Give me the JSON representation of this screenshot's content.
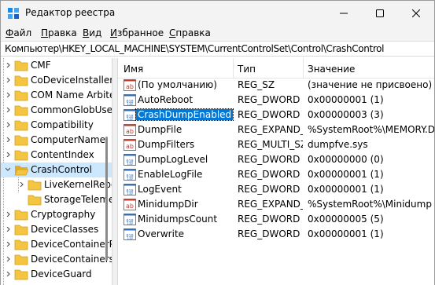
{
  "window": {
    "title": "Редактор реестра"
  },
  "menu": [
    {
      "accel": "Ф",
      "rest": "айл"
    },
    {
      "accel": "П",
      "rest": "равка"
    },
    {
      "accel": "В",
      "rest": "ид"
    },
    {
      "accel": "И",
      "rest": "збранное"
    },
    {
      "accel": "С",
      "rest": "правка"
    }
  ],
  "address": "Компьютер\\HKEY_LOCAL_MACHINE\\SYSTEM\\CurrentControlSet\\Control\\CrashControl",
  "tree": {
    "items": [
      {
        "label": "CMF"
      },
      {
        "label": "CoDeviceInstallers"
      },
      {
        "label": "COM Name Arbiter"
      },
      {
        "label": "CommonGlobUserSettings"
      },
      {
        "label": "Compatibility"
      },
      {
        "label": "ComputerName"
      },
      {
        "label": "ContentIndex"
      },
      {
        "label": "CrashControl"
      },
      {
        "label": "LiveKernelReports"
      },
      {
        "label": "StorageTelemetry"
      },
      {
        "label": "Cryptography"
      },
      {
        "label": "DeviceClasses"
      },
      {
        "label": "DeviceContainerPropertyUpdateEvents"
      },
      {
        "label": "DeviceContainers"
      },
      {
        "label": "DeviceGuard"
      }
    ]
  },
  "list": {
    "columns": {
      "name": "Имя",
      "type": "Тип",
      "data": "Значение"
    },
    "rows": [
      {
        "name": "(По умолчанию)",
        "type": "REG_SZ",
        "data": "(значение не присвоено)",
        "icon": "string-value-icon"
      },
      {
        "name": "AutoReboot",
        "type": "REG_DWORD",
        "data": "0x00000001 (1)",
        "icon": "binary-value-icon"
      },
      {
        "name": "CrashDumpEnabled",
        "type": "REG_DWORD",
        "data": "0x00000003 (3)",
        "icon": "binary-value-icon"
      },
      {
        "name": "DumpFile",
        "type": "REG_EXPAND_SZ",
        "data": "%SystemRoot%\\MEMORY.DMP",
        "icon": "string-value-icon"
      },
      {
        "name": "DumpFilters",
        "type": "REG_MULTI_SZ",
        "data": "dumpfve.sys",
        "icon": "string-value-icon"
      },
      {
        "name": "DumpLogLevel",
        "type": "REG_DWORD",
        "data": "0x00000000 (0)",
        "icon": "binary-value-icon"
      },
      {
        "name": "EnableLogFile",
        "type": "REG_DWORD",
        "data": "0x00000001 (1)",
        "icon": "binary-value-icon"
      },
      {
        "name": "LogEvent",
        "type": "REG_DWORD",
        "data": "0x00000001 (1)",
        "icon": "binary-value-icon"
      },
      {
        "name": "MinidumpDir",
        "type": "REG_EXPAND_SZ",
        "data": "%SystemRoot%\\Minidump",
        "icon": "string-value-icon"
      },
      {
        "name": "MinidumpsCount",
        "type": "REG_DWORD",
        "data": "0x00000005 (5)",
        "icon": "binary-value-icon"
      },
      {
        "name": "Overwrite",
        "type": "REG_DWORD",
        "data": "0x00000001 (1)",
        "icon": "binary-value-icon"
      }
    ]
  },
  "colors": {
    "selection": "#0078d7",
    "tree_selection": "#cce8ff",
    "folder": "#f4c542"
  }
}
